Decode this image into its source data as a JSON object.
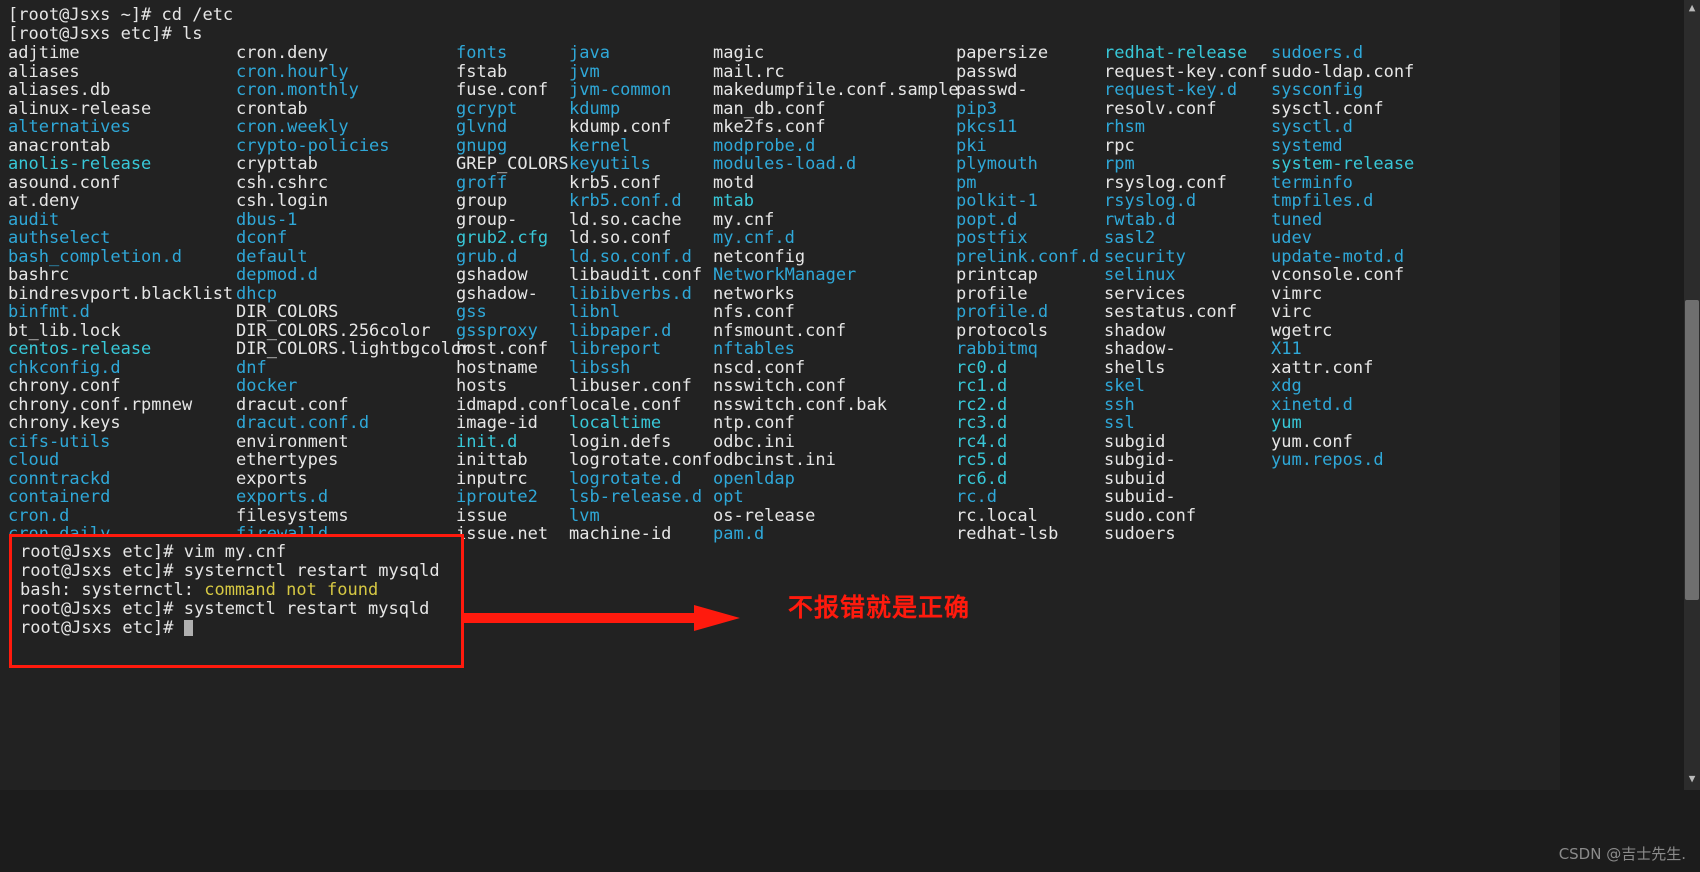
{
  "terminal": {
    "prompt_lines": [
      "[root@Jsxs ~]# cd /etc",
      "[root@Jsxs etc]# ls"
    ],
    "columns": [
      {
        "entries": [
          {
            "name": "adjtime",
            "kind": "file"
          },
          {
            "name": "aliases",
            "kind": "file"
          },
          {
            "name": "aliases.db",
            "kind": "file"
          },
          {
            "name": "alinux-release",
            "kind": "file"
          },
          {
            "name": "alternatives",
            "kind": "dir"
          },
          {
            "name": "anacrontab",
            "kind": "file"
          },
          {
            "name": "anolis-release",
            "kind": "link"
          },
          {
            "name": "asound.conf",
            "kind": "file"
          },
          {
            "name": "at.deny",
            "kind": "file"
          },
          {
            "name": "audit",
            "kind": "dir"
          },
          {
            "name": "authselect",
            "kind": "dir"
          },
          {
            "name": "bash_completion.d",
            "kind": "dir"
          },
          {
            "name": "bashrc",
            "kind": "file"
          },
          {
            "name": "bindresvport.blacklist",
            "kind": "file"
          },
          {
            "name": "binfmt.d",
            "kind": "dir"
          },
          {
            "name": "bt_lib.lock",
            "kind": "file"
          },
          {
            "name": "centos-release",
            "kind": "link"
          },
          {
            "name": "chkconfig.d",
            "kind": "dir"
          },
          {
            "name": "chrony.conf",
            "kind": "file"
          },
          {
            "name": "chrony.conf.rpmnew",
            "kind": "file"
          },
          {
            "name": "chrony.keys",
            "kind": "file"
          },
          {
            "name": "cifs-utils",
            "kind": "dir"
          },
          {
            "name": "cloud",
            "kind": "dir"
          },
          {
            "name": "conntrackd",
            "kind": "dir"
          },
          {
            "name": "containerd",
            "kind": "dir"
          },
          {
            "name": "cron.d",
            "kind": "dir"
          },
          {
            "name": "cron.daily",
            "kind": "dir"
          }
        ]
      },
      {
        "entries": [
          {
            "name": "cron.deny",
            "kind": "file"
          },
          {
            "name": "cron.hourly",
            "kind": "dir"
          },
          {
            "name": "cron.monthly",
            "kind": "dir"
          },
          {
            "name": "crontab",
            "kind": "file"
          },
          {
            "name": "cron.weekly",
            "kind": "dir"
          },
          {
            "name": "crypto-policies",
            "kind": "dir"
          },
          {
            "name": "crypttab",
            "kind": "file"
          },
          {
            "name": "csh.cshrc",
            "kind": "file"
          },
          {
            "name": "csh.login",
            "kind": "file"
          },
          {
            "name": "dbus-1",
            "kind": "dir"
          },
          {
            "name": "dconf",
            "kind": "dir"
          },
          {
            "name": "default",
            "kind": "dir"
          },
          {
            "name": "depmod.d",
            "kind": "dir"
          },
          {
            "name": "dhcp",
            "kind": "dir"
          },
          {
            "name": "DIR_COLORS",
            "kind": "file"
          },
          {
            "name": "DIR_COLORS.256color",
            "kind": "file"
          },
          {
            "name": "DIR_COLORS.lightbgcolor",
            "kind": "file"
          },
          {
            "name": "dnf",
            "kind": "dir"
          },
          {
            "name": "docker",
            "kind": "dir"
          },
          {
            "name": "dracut.conf",
            "kind": "file"
          },
          {
            "name": "dracut.conf.d",
            "kind": "dir"
          },
          {
            "name": "environment",
            "kind": "file"
          },
          {
            "name": "ethertypes",
            "kind": "file"
          },
          {
            "name": "exports",
            "kind": "file"
          },
          {
            "name": "exports.d",
            "kind": "dir"
          },
          {
            "name": "filesystems",
            "kind": "file"
          },
          {
            "name": "firewalld",
            "kind": "dir"
          }
        ]
      },
      {
        "entries": [
          {
            "name": "fonts",
            "kind": "dir"
          },
          {
            "name": "fstab",
            "kind": "file"
          },
          {
            "name": "fuse.conf",
            "kind": "file"
          },
          {
            "name": "gcrypt",
            "kind": "dir"
          },
          {
            "name": "glvnd",
            "kind": "dir"
          },
          {
            "name": "gnupg",
            "kind": "dir"
          },
          {
            "name": "GREP_COLORS",
            "kind": "file"
          },
          {
            "name": "groff",
            "kind": "dir"
          },
          {
            "name": "group",
            "kind": "file"
          },
          {
            "name": "group-",
            "kind": "file"
          },
          {
            "name": "grub2.cfg",
            "kind": "link"
          },
          {
            "name": "grub.d",
            "kind": "dir"
          },
          {
            "name": "gshadow",
            "kind": "file"
          },
          {
            "name": "gshadow-",
            "kind": "file"
          },
          {
            "name": "gss",
            "kind": "dir"
          },
          {
            "name": "gssproxy",
            "kind": "dir"
          },
          {
            "name": "host.conf",
            "kind": "file"
          },
          {
            "name": "hostname",
            "kind": "file"
          },
          {
            "name": "hosts",
            "kind": "file"
          },
          {
            "name": "idmapd.conf",
            "kind": "file"
          },
          {
            "name": "image-id",
            "kind": "file"
          },
          {
            "name": "init.d",
            "kind": "link"
          },
          {
            "name": "inittab",
            "kind": "file"
          },
          {
            "name": "inputrc",
            "kind": "file"
          },
          {
            "name": "iproute2",
            "kind": "dir"
          },
          {
            "name": "issue",
            "kind": "file"
          },
          {
            "name": "issue.net",
            "kind": "file"
          }
        ]
      },
      {
        "entries": [
          {
            "name": "java",
            "kind": "dir"
          },
          {
            "name": "jvm",
            "kind": "dir"
          },
          {
            "name": "jvm-common",
            "kind": "dir"
          },
          {
            "name": "kdump",
            "kind": "dir"
          },
          {
            "name": "kdump.conf",
            "kind": "file"
          },
          {
            "name": "kernel",
            "kind": "dir"
          },
          {
            "name": "keyutils",
            "kind": "dir"
          },
          {
            "name": "krb5.conf",
            "kind": "file"
          },
          {
            "name": "krb5.conf.d",
            "kind": "dir"
          },
          {
            "name": "ld.so.cache",
            "kind": "file"
          },
          {
            "name": "ld.so.conf",
            "kind": "file"
          },
          {
            "name": "ld.so.conf.d",
            "kind": "dir"
          },
          {
            "name": "libaudit.conf",
            "kind": "file"
          },
          {
            "name": "libibverbs.d",
            "kind": "dir"
          },
          {
            "name": "libnl",
            "kind": "dir"
          },
          {
            "name": "libpaper.d",
            "kind": "dir"
          },
          {
            "name": "libreport",
            "kind": "dir"
          },
          {
            "name": "libssh",
            "kind": "dir"
          },
          {
            "name": "libuser.conf",
            "kind": "file"
          },
          {
            "name": "locale.conf",
            "kind": "file"
          },
          {
            "name": "localtime",
            "kind": "link"
          },
          {
            "name": "login.defs",
            "kind": "file"
          },
          {
            "name": "logrotate.conf",
            "kind": "file"
          },
          {
            "name": "logrotate.d",
            "kind": "dir"
          },
          {
            "name": "lsb-release.d",
            "kind": "dir"
          },
          {
            "name": "lvm",
            "kind": "dir"
          },
          {
            "name": "machine-id",
            "kind": "file"
          }
        ]
      },
      {
        "entries": [
          {
            "name": "magic",
            "kind": "file"
          },
          {
            "name": "mail.rc",
            "kind": "file"
          },
          {
            "name": "makedumpfile.conf.sample",
            "kind": "file"
          },
          {
            "name": "man_db.conf",
            "kind": "file"
          },
          {
            "name": "mke2fs.conf",
            "kind": "file"
          },
          {
            "name": "modprobe.d",
            "kind": "dir"
          },
          {
            "name": "modules-load.d",
            "kind": "dir"
          },
          {
            "name": "motd",
            "kind": "file"
          },
          {
            "name": "mtab",
            "kind": "link"
          },
          {
            "name": "my.cnf",
            "kind": "file"
          },
          {
            "name": "my.cnf.d",
            "kind": "dir"
          },
          {
            "name": "netconfig",
            "kind": "file"
          },
          {
            "name": "NetworkManager",
            "kind": "dir"
          },
          {
            "name": "networks",
            "kind": "file"
          },
          {
            "name": "nfs.conf",
            "kind": "file"
          },
          {
            "name": "nfsmount.conf",
            "kind": "file"
          },
          {
            "name": "nftables",
            "kind": "dir"
          },
          {
            "name": "nscd.conf",
            "kind": "file"
          },
          {
            "name": "nsswitch.conf",
            "kind": "file"
          },
          {
            "name": "nsswitch.conf.bak",
            "kind": "file"
          },
          {
            "name": "ntp.conf",
            "kind": "file"
          },
          {
            "name": "odbc.ini",
            "kind": "file"
          },
          {
            "name": "odbcinst.ini",
            "kind": "file"
          },
          {
            "name": "openldap",
            "kind": "dir"
          },
          {
            "name": "opt",
            "kind": "dir"
          },
          {
            "name": "os-release",
            "kind": "file"
          },
          {
            "name": "pam.d",
            "kind": "dir"
          }
        ]
      },
      {
        "entries": [
          {
            "name": "papersize",
            "kind": "file"
          },
          {
            "name": "passwd",
            "kind": "file"
          },
          {
            "name": "passwd-",
            "kind": "file"
          },
          {
            "name": "pip3",
            "kind": "dir"
          },
          {
            "name": "pkcs11",
            "kind": "dir"
          },
          {
            "name": "pki",
            "kind": "dir"
          },
          {
            "name": "plymouth",
            "kind": "dir"
          },
          {
            "name": "pm",
            "kind": "dir"
          },
          {
            "name": "polkit-1",
            "kind": "dir"
          },
          {
            "name": "popt.d",
            "kind": "dir"
          },
          {
            "name": "postfix",
            "kind": "dir"
          },
          {
            "name": "prelink.conf.d",
            "kind": "dir"
          },
          {
            "name": "printcap",
            "kind": "file"
          },
          {
            "name": "profile",
            "kind": "file"
          },
          {
            "name": "profile.d",
            "kind": "dir"
          },
          {
            "name": "protocols",
            "kind": "file"
          },
          {
            "name": "rabbitmq",
            "kind": "dir"
          },
          {
            "name": "rc0.d",
            "kind": "link"
          },
          {
            "name": "rc1.d",
            "kind": "link"
          },
          {
            "name": "rc2.d",
            "kind": "link"
          },
          {
            "name": "rc3.d",
            "kind": "link"
          },
          {
            "name": "rc4.d",
            "kind": "link"
          },
          {
            "name": "rc5.d",
            "kind": "link"
          },
          {
            "name": "rc6.d",
            "kind": "link"
          },
          {
            "name": "rc.d",
            "kind": "dir"
          },
          {
            "name": "rc.local",
            "kind": "file"
          },
          {
            "name": "redhat-lsb",
            "kind": "file"
          }
        ]
      },
      {
        "entries": [
          {
            "name": "redhat-release",
            "kind": "link"
          },
          {
            "name": "request-key.conf",
            "kind": "file"
          },
          {
            "name": "request-key.d",
            "kind": "dir"
          },
          {
            "name": "resolv.conf",
            "kind": "file"
          },
          {
            "name": "rhsm",
            "kind": "dir"
          },
          {
            "name": "rpc",
            "kind": "file"
          },
          {
            "name": "rpm",
            "kind": "dir"
          },
          {
            "name": "rsyslog.conf",
            "kind": "file"
          },
          {
            "name": "rsyslog.d",
            "kind": "dir"
          },
          {
            "name": "rwtab.d",
            "kind": "dir"
          },
          {
            "name": "sasl2",
            "kind": "dir"
          },
          {
            "name": "security",
            "kind": "dir"
          },
          {
            "name": "selinux",
            "kind": "dir"
          },
          {
            "name": "services",
            "kind": "file"
          },
          {
            "name": "sestatus.conf",
            "kind": "file"
          },
          {
            "name": "shadow",
            "kind": "file"
          },
          {
            "name": "shadow-",
            "kind": "file"
          },
          {
            "name": "shells",
            "kind": "file"
          },
          {
            "name": "skel",
            "kind": "dir"
          },
          {
            "name": "ssh",
            "kind": "dir"
          },
          {
            "name": "ssl",
            "kind": "dir"
          },
          {
            "name": "subgid",
            "kind": "file"
          },
          {
            "name": "subgid-",
            "kind": "file"
          },
          {
            "name": "subuid",
            "kind": "file"
          },
          {
            "name": "subuid-",
            "kind": "file"
          },
          {
            "name": "sudo.conf",
            "kind": "file"
          },
          {
            "name": "sudoers",
            "kind": "file"
          }
        ]
      },
      {
        "entries": [
          {
            "name": "sudoers.d",
            "kind": "dir"
          },
          {
            "name": "sudo-ldap.conf",
            "kind": "file"
          },
          {
            "name": "sysconfig",
            "kind": "dir"
          },
          {
            "name": "sysctl.conf",
            "kind": "file"
          },
          {
            "name": "sysctl.d",
            "kind": "dir"
          },
          {
            "name": "systemd",
            "kind": "dir"
          },
          {
            "name": "system-release",
            "kind": "link"
          },
          {
            "name": "terminfo",
            "kind": "dir"
          },
          {
            "name": "tmpfiles.d",
            "kind": "dir"
          },
          {
            "name": "tuned",
            "kind": "dir"
          },
          {
            "name": "udev",
            "kind": "dir"
          },
          {
            "name": "update-motd.d",
            "kind": "dir"
          },
          {
            "name": "vconsole.conf",
            "kind": "file"
          },
          {
            "name": "vimrc",
            "kind": "file"
          },
          {
            "name": "virc",
            "kind": "file"
          },
          {
            "name": "wgetrc",
            "kind": "file"
          },
          {
            "name": "X11",
            "kind": "dir"
          },
          {
            "name": "xattr.conf",
            "kind": "file"
          },
          {
            "name": "xdg",
            "kind": "dir"
          },
          {
            "name": "xinetd.d",
            "kind": "dir"
          },
          {
            "name": "yum",
            "kind": "link"
          },
          {
            "name": "yum.conf",
            "kind": "file"
          },
          {
            "name": "yum.repos.d",
            "kind": "dir"
          }
        ]
      }
    ]
  },
  "highlight_box": {
    "lines": [
      {
        "prompt": "root@Jsxs etc]# ",
        "command": "vim my.cnf",
        "type": "command"
      },
      {
        "prompt": "root@Jsxs etc]# ",
        "command": "systernctl restart mysqld",
        "type": "command"
      },
      {
        "prefix": "bash: systernctl: ",
        "error": "command not found",
        "type": "error"
      },
      {
        "prompt": "root@Jsxs etc]# ",
        "command": "systemctl restart mysqld",
        "type": "command"
      },
      {
        "prompt": "root@Jsxs etc]# ",
        "command": "",
        "type": "cursor"
      }
    ]
  },
  "annotation": {
    "text": "不报错就是正确",
    "color": "#ff1a0d"
  },
  "watermark": {
    "text": "CSDN @吉士先生."
  },
  "scrollbar": {
    "up_arrow": "▲",
    "down_arrow": "▼"
  }
}
